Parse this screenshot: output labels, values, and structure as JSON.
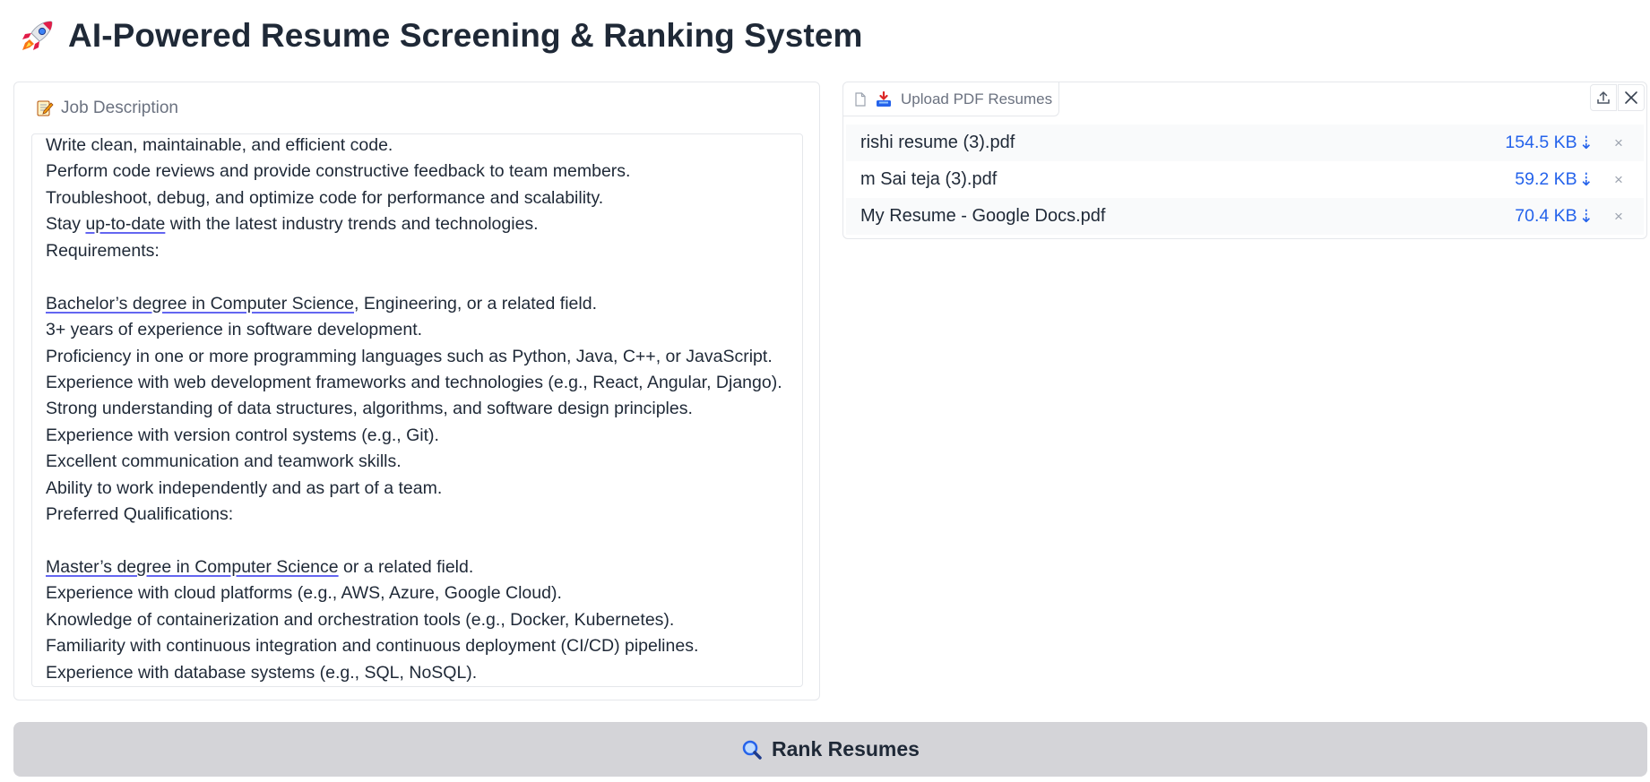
{
  "header": {
    "icon": "rocket-icon",
    "title": "AI-Powered Resume Screening & Ranking System"
  },
  "job_description": {
    "label": "Job Description",
    "label_icon": "memo-icon",
    "lines": [
      [
        "Write clean, maintainable, and efficient code."
      ],
      [
        "Perform code reviews and provide constructive feedback to team members."
      ],
      [
        "Troubleshoot, debug, and optimize code for performance and scalability."
      ],
      [
        "Stay ",
        "up-to-date",
        " with the latest industry trends and technologies."
      ],
      [
        "Requirements:"
      ],
      [
        ""
      ],
      [
        "",
        "Bachelor’s degree in Computer Science",
        ", Engineering, or a related field."
      ],
      [
        "3+ years of experience in software development."
      ],
      [
        "Proficiency in one or more programming languages such as Python, Java, C++, or JavaScript."
      ],
      [
        "Experience with web development frameworks and technologies (e.g., React, Angular, Django)."
      ],
      [
        "Strong understanding of data structures, algorithms, and software design principles."
      ],
      [
        "Experience with version control systems (e.g., Git)."
      ],
      [
        "Excellent communication and teamwork skills."
      ],
      [
        "Ability to work independently and as part of a team."
      ],
      [
        "Preferred Qualifications:"
      ],
      [
        ""
      ],
      [
        "",
        "Master’s degree in Computer Science",
        " or a related field."
      ],
      [
        "Experience with cloud platforms (e.g., AWS, Azure, Google Cloud)."
      ],
      [
        "Knowledge of containerization and orchestration tools (e.g., Docker, Kubernetes)."
      ],
      [
        "Familiarity with continuous integration and continuous deployment (CI/CD) pipelines."
      ],
      [
        "Experience with database systems (e.g., SQL, NoSQL)."
      ]
    ]
  },
  "uploader": {
    "tab_label": "Upload PDF Resumes",
    "files": [
      {
        "name": "rishi resume (3).pdf",
        "size": "154.5 KB"
      },
      {
        "name": "m Sai teja (3).pdf",
        "size": "59.2 KB"
      },
      {
        "name": "My Resume - Google Docs.pdf",
        "size": "70.4 KB"
      }
    ],
    "remove_symbol": "×",
    "download_symbol": "⇣"
  },
  "actions": {
    "rank_label": "Rank Resumes",
    "rank_icon": "magnifier-icon"
  },
  "colors": {
    "accent_link": "#2563eb",
    "button_bg": "#d4d4d8",
    "spell_underline": "#6366f1"
  }
}
